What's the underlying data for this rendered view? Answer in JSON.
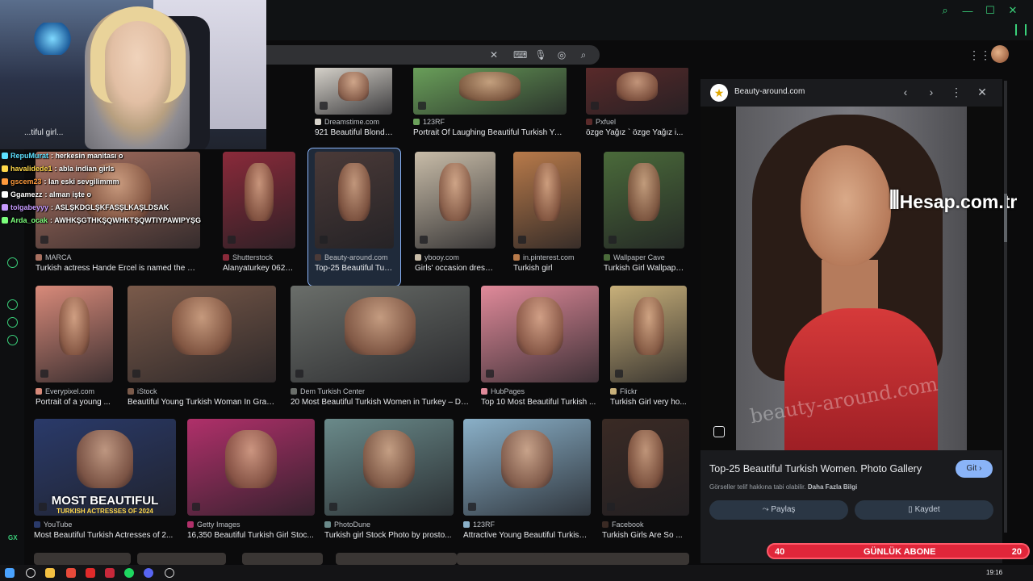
{
  "browser": {
    "window_controls": [
      "search-icon",
      "minimize-icon",
      "maximize-icon",
      "close-icon"
    ],
    "accent": "#3ad07a"
  },
  "chat": [
    {
      "user": "RepuMurat",
      "color": "#5de0ff",
      "message": "herkesin manitası o"
    },
    {
      "user": "havalidede1",
      "color": "#ffd84a",
      "message": "abla indian girls"
    },
    {
      "user": "gscem23",
      "color": "#ff9a3c",
      "message": "lan eski sevgilimmm"
    },
    {
      "user": "Ggamezz",
      "color": "#ffffff",
      "message": "alman işte o"
    },
    {
      "user": "tolgabeyyy",
      "color": "#c79bff",
      "message": "ASLŞKDGLŞKFASŞLKAŞLDSAK"
    },
    {
      "user": "Arda_ocak",
      "color": "#7cff7c",
      "message": "AWHKŞGTHKŞQWHKTŞQWTIYPAWIPYŞG"
    }
  ],
  "results": [
    {
      "source": "",
      "title": "...tiful girl...",
      "color": "#6b4a3a"
    },
    {
      "source": "Dreamstime.com",
      "title": "921 Beautiful Blonde ...",
      "color": "#d8d4cc"
    },
    {
      "source": "123RF",
      "title": "Portrait Of Laughing Beautiful Turkish Young...",
      "color": "#6aa05a"
    },
    {
      "source": "Pxfuel",
      "title": "özge Yağız ` özge Yağız i...",
      "color": "#5a2a2a"
    },
    {
      "source": "MARCA",
      "title": "Turkish actress Hande Ercel is named the mo...",
      "color": "#a87060"
    },
    {
      "source": "Shutterstock",
      "title": "Alanyaturkey 06222...",
      "color": "#8a2a3a"
    },
    {
      "source": "Beauty-around.com",
      "title": "Top-25 Beautiful Turki...",
      "color": "#4a3a38"
    },
    {
      "source": "ybooy.com",
      "title": "Girls' occasion dress, ...",
      "color": "#c8bca8"
    },
    {
      "source": "in.pinterest.com",
      "title": "Turkish girl",
      "color": "#b87a4a"
    },
    {
      "source": "Wallpaper Cave",
      "title": "Turkish Girl Wallpape...",
      "color": "#4a6a3a"
    },
    {
      "source": "Everypixel.com",
      "title": "Portrait of a young ...",
      "color": "#d88a7a"
    },
    {
      "source": "iStock",
      "title": "Beautiful Young Turkish Woman In Gran...",
      "color": "#7a5a4a"
    },
    {
      "source": "Dem Turkish Center",
      "title": "20 Most Beautiful Turkish Women in Turkey – De...",
      "color": "#6a6e6a"
    },
    {
      "source": "HubPages",
      "title": "Top 10 Most Beautiful Turkish ...",
      "color": "#e08a9a"
    },
    {
      "source": "Flickr",
      "title": "Turkish Girl very ho...",
      "color": "#c8b07a"
    },
    {
      "source": "YouTube",
      "title": "Most Beautiful Turkish Actresses of 2...",
      "color": "#2a3a6a"
    },
    {
      "source": "Getty Images",
      "title": "16,350 Beautiful Turkish Girl Stoc...",
      "color": "#b0306a"
    },
    {
      "source": "PhotoDune",
      "title": "Turkish girl Stock Photo by prosto...",
      "color": "#6a8a8a"
    },
    {
      "source": "123RF",
      "title": "Attractive Young Beautiful Turkish Girl W...",
      "color": "#8ab0c8"
    },
    {
      "source": "Facebook",
      "title": "Turkish Girls Are So ...",
      "color": "#3a2a24"
    }
  ],
  "youtube_overlay": {
    "line1": "MOST BEAUTIFUL",
    "line2": "TURKISH ACTRESSES OF 2024"
  },
  "panel": {
    "site": "Beauty-around.com",
    "title": "Top-25 Beautiful Turkish Women. Photo Gallery",
    "go_label": "Git",
    "copyright": "Görseller telif hakkına tabi olabilir.",
    "more_info": "Daha Fazla Bilgi",
    "share_label": "Paylaş",
    "save_label": "Kaydet",
    "watermark": "beauty-around.com",
    "hesap": "Hesap.com.tr"
  },
  "abone": {
    "left": "40",
    "label": "GÜNLÜK ABONE",
    "right": "20"
  },
  "sidebar_label": "GX",
  "clock": "19:16"
}
